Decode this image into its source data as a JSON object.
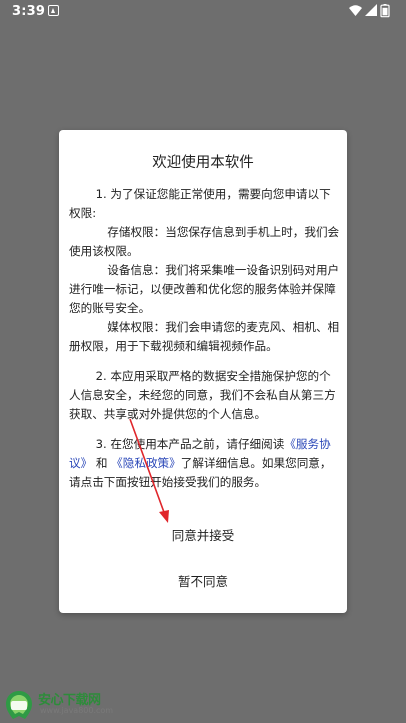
{
  "status_bar": {
    "time": "3:39",
    "notification_icon": "photos-notification-icon",
    "wifi_icon": "wifi-icon",
    "signal_icon": "cell-signal-icon",
    "battery_icon": "battery-icon"
  },
  "dialog": {
    "title": "欢迎使用本软件",
    "p1": "1. 为了保证您能正常使用，需要向您申请以下权限:",
    "p1_storage": "存储权限：当您保存信息到手机上时，我们会使用该权限。",
    "p1_device": "设备信息：我们将采集唯一设备识别码对用户进行唯一标记，以便改善和优化您的服务体验并保障您的账号安全。",
    "p1_media": "媒体权限：我们会申请您的麦克风、相机、相册权限，用于下载视频和编辑视频作品。",
    "p2": "2. 本应用采取严格的数据安全措施保护您的个人信息安全，未经您的同意，我们不会私自从第三方获取、共享或对外提供您的个人信息。",
    "p3_before": "3. 在您使用本产品之前，请仔细阅读",
    "link_service": "《服务协议》",
    "and_text": " 和 ",
    "link_privacy": "《隐私政策》",
    "p3_after": "了解详细信息。如果您同意，请点击下面按钮开始接受我们的服务。",
    "agree_button": "同意并接受",
    "disagree_button": "暂不同意",
    "arrow_color": "#e0262b"
  },
  "watermark": {
    "brand_text": "安心下载网",
    "url_text": "www.java800.com",
    "badge_text": "安心下载"
  }
}
